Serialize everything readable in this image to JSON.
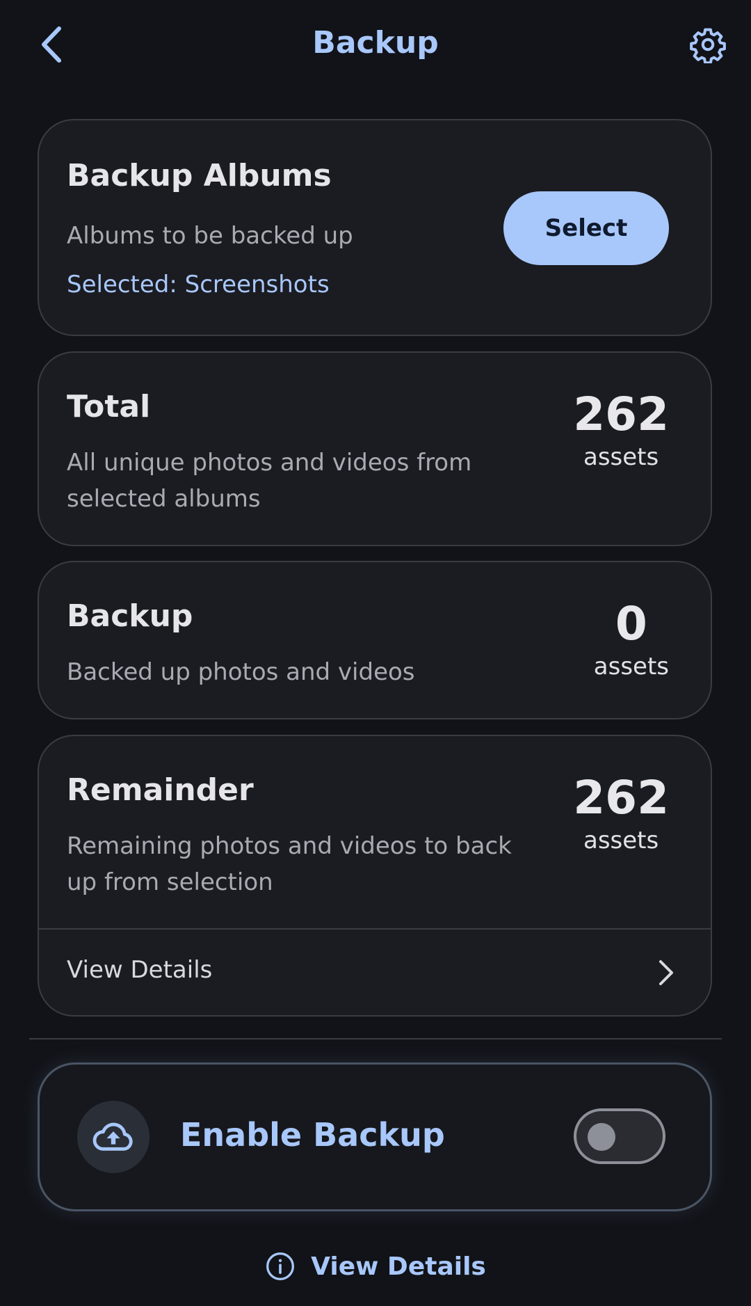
{
  "header": {
    "title": "Backup",
    "back_icon": "chevron-left-icon",
    "settings_icon": "gear-icon"
  },
  "albums_card": {
    "title": "Backup Albums",
    "description": "Albums to be backed up",
    "selected": "Selected: Screenshots",
    "select_button": "Select"
  },
  "total_card": {
    "title": "Total",
    "description_line1": "All unique photos and videos from",
    "description_line2": "selected albums",
    "count": "262",
    "unit": "assets"
  },
  "backup_card": {
    "title": "Backup",
    "description": "Backed up photos and videos",
    "count": "0",
    "unit": "assets"
  },
  "remainder_card": {
    "title": "Remainder",
    "description_line1": "Remaining photos and videos to back",
    "description_line2": "up from selection",
    "count": "262",
    "unit": "assets",
    "view_details": "View Details"
  },
  "enable_backup": {
    "label": "Enable Backup",
    "icon": "cloud-upload-icon",
    "enabled": false
  },
  "footer": {
    "view_details": "View Details",
    "icon": "info-icon"
  },
  "colors": {
    "accent": "#a8c7fa",
    "background": "#111318",
    "card": "#1b1c21"
  }
}
